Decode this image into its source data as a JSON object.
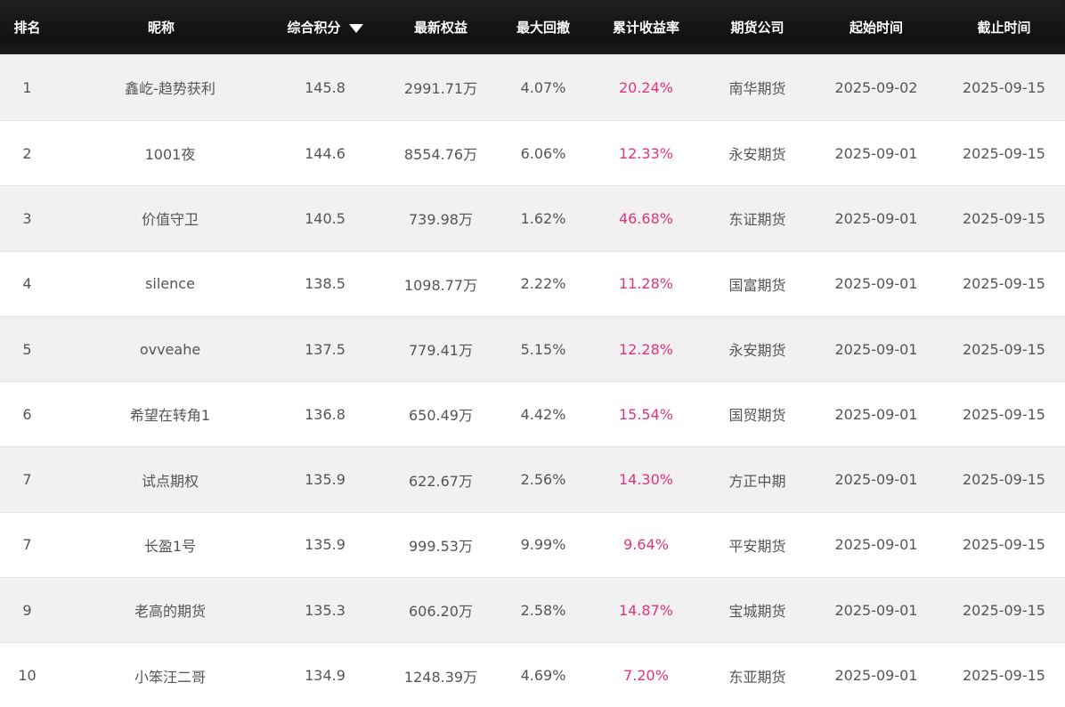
{
  "columns": {
    "rank": "排名",
    "nickname": "昵称",
    "score": "综合积分",
    "equity": "最新权益",
    "drawdown": "最大回撤",
    "return": "累计收益率",
    "company": "期货公司",
    "start": "起始时间",
    "end": "截止时间"
  },
  "colors": {
    "header_bg": "#151515",
    "return_color": "#e4337d",
    "odd_row_bg": "#f1f1f1"
  },
  "rows": [
    {
      "rank": "1",
      "nickname": "鑫屹-趋势获利",
      "score": "145.8",
      "equity": "2991.71万",
      "drawdown": "4.07%",
      "return": "20.24%",
      "company": "南华期货",
      "start": "2025-09-02",
      "end": "2025-09-15"
    },
    {
      "rank": "2",
      "nickname": "1001夜",
      "score": "144.6",
      "equity": "8554.76万",
      "drawdown": "6.06%",
      "return": "12.33%",
      "company": "永安期货",
      "start": "2025-09-01",
      "end": "2025-09-15"
    },
    {
      "rank": "3",
      "nickname": "价值守卫",
      "score": "140.5",
      "equity": "739.98万",
      "drawdown": "1.62%",
      "return": "46.68%",
      "company": "东证期货",
      "start": "2025-09-01",
      "end": "2025-09-15"
    },
    {
      "rank": "4",
      "nickname": "silence",
      "score": "138.5",
      "equity": "1098.77万",
      "drawdown": "2.22%",
      "return": "11.28%",
      "company": "国富期货",
      "start": "2025-09-01",
      "end": "2025-09-15"
    },
    {
      "rank": "5",
      "nickname": "ovveahe",
      "score": "137.5",
      "equity": "779.41万",
      "drawdown": "5.15%",
      "return": "12.28%",
      "company": "永安期货",
      "start": "2025-09-01",
      "end": "2025-09-15"
    },
    {
      "rank": "6",
      "nickname": "希望在转角1",
      "score": "136.8",
      "equity": "650.49万",
      "drawdown": "4.42%",
      "return": "15.54%",
      "company": "国贸期货",
      "start": "2025-09-01",
      "end": "2025-09-15"
    },
    {
      "rank": "7",
      "nickname": "试点期权",
      "score": "135.9",
      "equity": "622.67万",
      "drawdown": "2.56%",
      "return": "14.30%",
      "company": "方正中期",
      "start": "2025-09-01",
      "end": "2025-09-15"
    },
    {
      "rank": "7",
      "nickname": "长盈1号",
      "score": "135.9",
      "equity": "999.53万",
      "drawdown": "9.99%",
      "return": "9.64%",
      "company": "平安期货",
      "start": "2025-09-01",
      "end": "2025-09-15"
    },
    {
      "rank": "9",
      "nickname": "老高的期货",
      "score": "135.3",
      "equity": "606.20万",
      "drawdown": "2.58%",
      "return": "14.87%",
      "company": "宝城期货",
      "start": "2025-09-01",
      "end": "2025-09-15"
    },
    {
      "rank": "10",
      "nickname": "小笨汪二哥",
      "score": "134.9",
      "equity": "1248.39万",
      "drawdown": "4.69%",
      "return": "7.20%",
      "company": "东亚期货",
      "start": "2025-09-01",
      "end": "2025-09-15"
    }
  ]
}
